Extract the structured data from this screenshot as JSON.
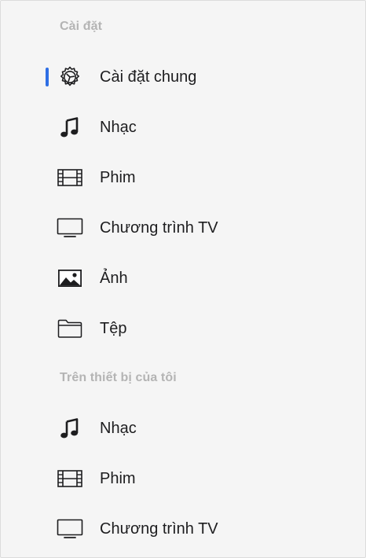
{
  "accent_color": "#2f6fe5",
  "sections": [
    {
      "header": "Cài đặt",
      "items": [
        {
          "label": "Cài đặt chung",
          "icon": "gear-icon",
          "selected": true
        },
        {
          "label": "Nhạc",
          "icon": "music-note-icon",
          "selected": false
        },
        {
          "label": "Phim",
          "icon": "film-icon",
          "selected": false
        },
        {
          "label": "Chương trình TV",
          "icon": "tv-icon",
          "selected": false
        },
        {
          "label": "Ảnh",
          "icon": "photo-icon",
          "selected": false
        },
        {
          "label": "Tệp",
          "icon": "folder-icon",
          "selected": false
        }
      ]
    },
    {
      "header": "Trên thiết bị của tôi",
      "items": [
        {
          "label": "Nhạc",
          "icon": "music-note-icon",
          "selected": false
        },
        {
          "label": "Phim",
          "icon": "film-icon",
          "selected": false
        },
        {
          "label": "Chương trình TV",
          "icon": "tv-icon",
          "selected": false
        }
      ]
    }
  ]
}
